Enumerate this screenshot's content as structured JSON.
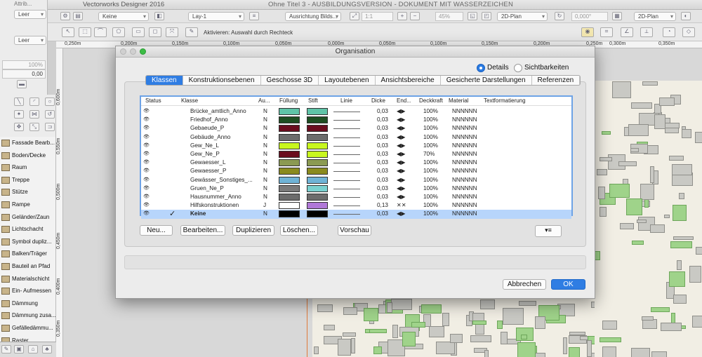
{
  "app": {
    "title": "Vectorworks Designer 2016",
    "document": "Ohne Titel 3 - AUSBILDUNGSVERSION - DOKUMENT MIT WASSERZEICHEN"
  },
  "toolbar": {
    "class_select": "Keine",
    "layer_select": "Lay-1",
    "alignment_select": "Ausrichtung Bilds...",
    "scale_field": "1:1",
    "zoom_field": "45%",
    "view_select": "2D-Plan",
    "angle_field": "0,000°",
    "projection_select": "2D-Plan",
    "mode_hint": "Aktivieren: Auswahl durch Rechteck"
  },
  "ruler": {
    "h_ticks": [
      "0,250m",
      "0,200m",
      "0,150m",
      "0,100m",
      "0,050m",
      "0,000m",
      "0,050m",
      "0,100m",
      "0,150m",
      "0,200m",
      "0,250m",
      "0,300m",
      "0,350m"
    ],
    "v_ticks": [
      "0,600m",
      "0,550m",
      "0,500m",
      "0,450m",
      "0,400m",
      "0,350m"
    ]
  },
  "attributes": {
    "title": "Attrib...",
    "fill_label": "Leer",
    "pen_label": "Leer",
    "opacity": "100%",
    "thickness": "0,00"
  },
  "tool_list": [
    "Fassade Bearb...",
    "Boden/Decke",
    "Raum",
    "Treppe",
    "Stütze",
    "Rampe",
    "Geländer/Zaun",
    "Lichtschacht",
    "Symbol dupliz...",
    "Balken/Träger",
    "Bauteil an Pfad",
    "Materialschicht",
    "Ein- Aufmessen",
    "Dämmung",
    "Dämmung zusa...",
    "Gefälledämmu...",
    "Raster"
  ],
  "dialog": {
    "title": "Organisation",
    "radio_details": "Details",
    "radio_visibility": "Sichtbarkeiten",
    "tabs": [
      "Klassen",
      "Konstruktionsebenen",
      "Geschosse 3D",
      "Layoutebenen",
      "Ansichtsbereiche",
      "Gesicherte Darstellungen",
      "Referenzen"
    ],
    "columns": [
      "Status",
      "Klasse",
      "Au...",
      "Füllung",
      "Stift",
      "Linie",
      "Dicke",
      "End...",
      "Deckkraft",
      "Material",
      "Textformatierung"
    ],
    "rows": [
      {
        "name": "Brücke_amtlich_Anno",
        "au": "N",
        "fill": "#5fc3a7",
        "pen": "#5fc3a7",
        "dicke": "0,03",
        "end": "◀▶",
        "deck": "100%",
        "mat": "NNNNNN",
        "check": ""
      },
      {
        "name": "Friedhof_Anno",
        "au": "N",
        "fill": "#1e4e22",
        "pen": "#1e4e22",
        "dicke": "0,03",
        "end": "◀▶",
        "deck": "100%",
        "mat": "NNNNNN",
        "check": ""
      },
      {
        "name": "Gebaeude_P",
        "au": "N",
        "fill": "#6a0c1e",
        "pen": "#6a0c1e",
        "dicke": "0,03",
        "end": "◀▶",
        "deck": "100%",
        "mat": "NNNNNN",
        "check": ""
      },
      {
        "name": "Gebäude_Anno",
        "au": "N",
        "fill": "#6c6c6c",
        "pen": "#6c6c6c",
        "dicke": "0,03",
        "end": "◀▶",
        "deck": "100%",
        "mat": "NNNNNN",
        "check": ""
      },
      {
        "name": "Gew_Ne_L",
        "au": "N",
        "fill": "#c8f71e",
        "pen": "#c8f71e",
        "dicke": "0,03",
        "end": "◀▶",
        "deck": "100%",
        "mat": "NNNNNN",
        "check": ""
      },
      {
        "name": "Gew_Ne_P",
        "au": "N",
        "fill": "#6a0c1e",
        "pen": "#c8f71e",
        "dicke": "0,03",
        "end": "◀▶",
        "deck": "70%",
        "mat": "NNNNNN",
        "check": ""
      },
      {
        "name": "Gewaesser_L",
        "au": "N",
        "fill": "#8b9a52",
        "pen": "#8b9a52",
        "dicke": "0,03",
        "end": "◀▶",
        "deck": "100%",
        "mat": "NNNNNN",
        "check": ""
      },
      {
        "name": "Gewaesser_P",
        "au": "N",
        "fill": "#8a8a1e",
        "pen": "#8a8a1e",
        "dicke": "0,03",
        "end": "◀▶",
        "deck": "100%",
        "mat": "NNNNNN",
        "check": ""
      },
      {
        "name": "Gewässer_Sonstiges_...",
        "au": "N",
        "fill": "#6fb3d6",
        "pen": "#6fb3d6",
        "dicke": "0,03",
        "end": "◀▶",
        "deck": "100%",
        "mat": "NNNNNN",
        "check": ""
      },
      {
        "name": "Gruen_Ne_P",
        "au": "N",
        "fill": "#7a7a7a",
        "pen": "#7ad0cf",
        "dicke": "0,03",
        "end": "◀▶",
        "deck": "100%",
        "mat": "NNNNNN",
        "check": ""
      },
      {
        "name": "Hausnummer_Anno",
        "au": "N",
        "fill": "#6c6c6c",
        "pen": "#6c6c6c",
        "dicke": "0,03",
        "end": "◀▶",
        "deck": "100%",
        "mat": "NNNNNN",
        "check": ""
      },
      {
        "name": "Hilfskonstruktionen",
        "au": "J",
        "fill": "#ffffff",
        "pen": "#b078d8",
        "dicke": "0,13",
        "end": "✕✕",
        "deck": "100%",
        "mat": "NNNNNN",
        "check": ""
      },
      {
        "name": "Keine",
        "au": "N",
        "fill": "#000000",
        "pen": "#000000",
        "dicke": "0,03",
        "end": "◀▶",
        "deck": "100%",
        "mat": "NNNNNN",
        "check": "✓"
      }
    ],
    "buttons": [
      "Neu...",
      "Bearbeiten...",
      "Duplizieren",
      "Löschen...",
      "Vorschau"
    ],
    "cancel": "Abbrechen",
    "ok": "OK"
  }
}
